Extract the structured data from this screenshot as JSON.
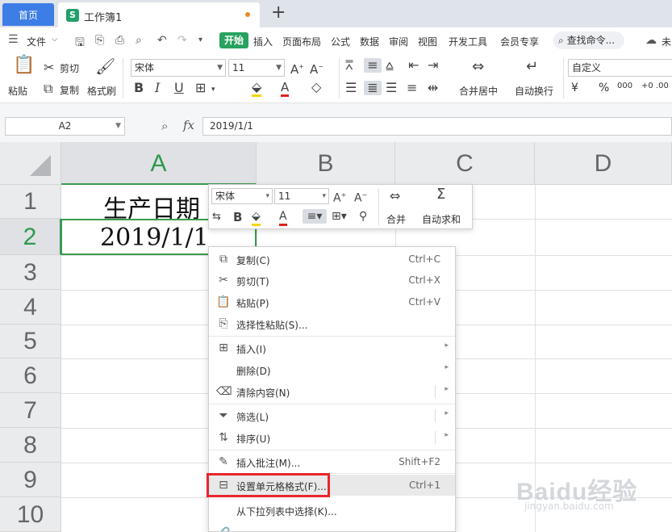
{
  "tabs": {
    "home": "首页",
    "doc": "工作簿1",
    "doc_icon": "S",
    "add": "+"
  },
  "menu": {
    "file": "文件",
    "items": [
      "开始",
      "插入",
      "页面布局",
      "公式",
      "数据",
      "审阅",
      "视图",
      "开发工具",
      "会员专享"
    ],
    "search": "查找命令...",
    "right_partial": "未"
  },
  "ribbon": {
    "paste": "粘贴",
    "cut": "剪切",
    "copy": "复制",
    "format_painter": "格式刷",
    "font_name": "宋体",
    "font_size": "11",
    "merge_center": "合并居中",
    "wrap_text": "自动换行",
    "number_format": "自定义",
    "currency": "¥",
    "percent": "%",
    "thousands": "000",
    "decimals": "+0 .00"
  },
  "formula_bar": {
    "cell_ref": "A2",
    "fx": "fx",
    "value": "2019/1/1"
  },
  "grid": {
    "columns": [
      "A",
      "B",
      "C",
      "D"
    ],
    "rows": [
      "1",
      "2",
      "3",
      "4",
      "5",
      "6",
      "7",
      "8",
      "9",
      "10"
    ],
    "a1": "生产日期",
    "a2": "2019/1/1"
  },
  "mini_toolbar": {
    "font_name": "宋体",
    "font_size": "11",
    "merge": "合并",
    "autosum": "自动求和"
  },
  "context_menu": [
    {
      "label": "复制(C)",
      "shortcut": "Ctrl+C",
      "icon": "copy-icon"
    },
    {
      "label": "剪切(T)",
      "shortcut": "Ctrl+X",
      "icon": "scissors-icon"
    },
    {
      "label": "粘贴(P)",
      "shortcut": "Ctrl+V",
      "icon": "paste-icon"
    },
    {
      "label": "选择性粘贴(S)...",
      "shortcut": "",
      "icon": "paste-special-icon"
    },
    {
      "label": "插入(I)",
      "shortcut": "",
      "icon": "insert-icon"
    },
    {
      "label": "删除(D)",
      "shortcut": "",
      "icon": ""
    },
    {
      "label": "清除内容(N)",
      "shortcut": "",
      "icon": "eraser-icon"
    },
    {
      "label": "筛选(L)",
      "shortcut": "",
      "icon": "filter-icon"
    },
    {
      "label": "排序(U)",
      "shortcut": "",
      "icon": "sort-icon"
    },
    {
      "label": "插入批注(M)...",
      "shortcut": "Shift+F2",
      "icon": "comment-icon"
    },
    {
      "label": "设置单元格格式(F)...",
      "shortcut": "Ctrl+1",
      "icon": "format-cells-icon"
    },
    {
      "label": "从下拉列表中选择(K)...",
      "shortcut": "",
      "icon": ""
    }
  ],
  "watermark": {
    "brand": "Baidu经验",
    "url": "jingyan.baidu.com"
  },
  "colors": {
    "accent_green": "#27a25f",
    "tab_blue": "#3d7de6",
    "highlight_red": "#e8262b"
  }
}
